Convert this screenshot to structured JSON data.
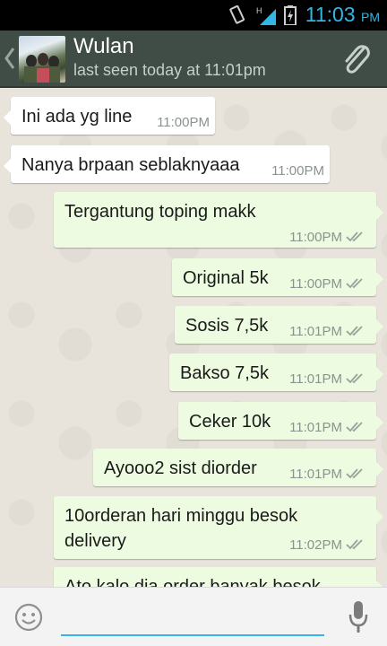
{
  "status_bar": {
    "time": "11:03",
    "ampm": "PM",
    "accent": "#33b5e5"
  },
  "header": {
    "contact_name": "Wulan",
    "last_seen": "last seen today at 11:01pm",
    "icons": {
      "back": "chevron-left-icon",
      "attach": "paperclip-icon"
    }
  },
  "messages": [
    {
      "direction": "in",
      "text": "Ini ada yg line",
      "time": "11:00PM"
    },
    {
      "direction": "in",
      "text": "Nanya brpaan seblaknyaaa",
      "time": "11:00PM"
    },
    {
      "direction": "out",
      "text": "Tergantung toping makk",
      "time": "11:00PM",
      "status": "read"
    },
    {
      "direction": "out",
      "text": "Original 5k",
      "time": "11:00PM",
      "status": "read"
    },
    {
      "direction": "out",
      "text": "Sosis 7,5k",
      "time": "11:01PM",
      "status": "read"
    },
    {
      "direction": "out",
      "text": "Bakso 7,5k",
      "time": "11:01PM",
      "status": "read"
    },
    {
      "direction": "out",
      "text": "Ceker 10k",
      "time": "11:01PM",
      "status": "read"
    },
    {
      "direction": "out",
      "text": "Ayooo2 sist diorder",
      "time": "11:01PM",
      "status": "read"
    },
    {
      "direction": "out",
      "text": "10orderan hari minggu besok delivery",
      "time": "11:02PM",
      "status": "read"
    },
    {
      "direction": "out",
      "text": "Ato kalo dia order banyak besok",
      "time": "",
      "status": ""
    }
  ],
  "composer": {
    "placeholder": "",
    "icons": {
      "emoji": "smiley-icon",
      "mic": "microphone-icon"
    }
  },
  "colors": {
    "header_bg": "#3f4d46",
    "incoming": "#ffffff",
    "outgoing": "#edfbe1",
    "chat_bg": "#e8e4dc"
  }
}
